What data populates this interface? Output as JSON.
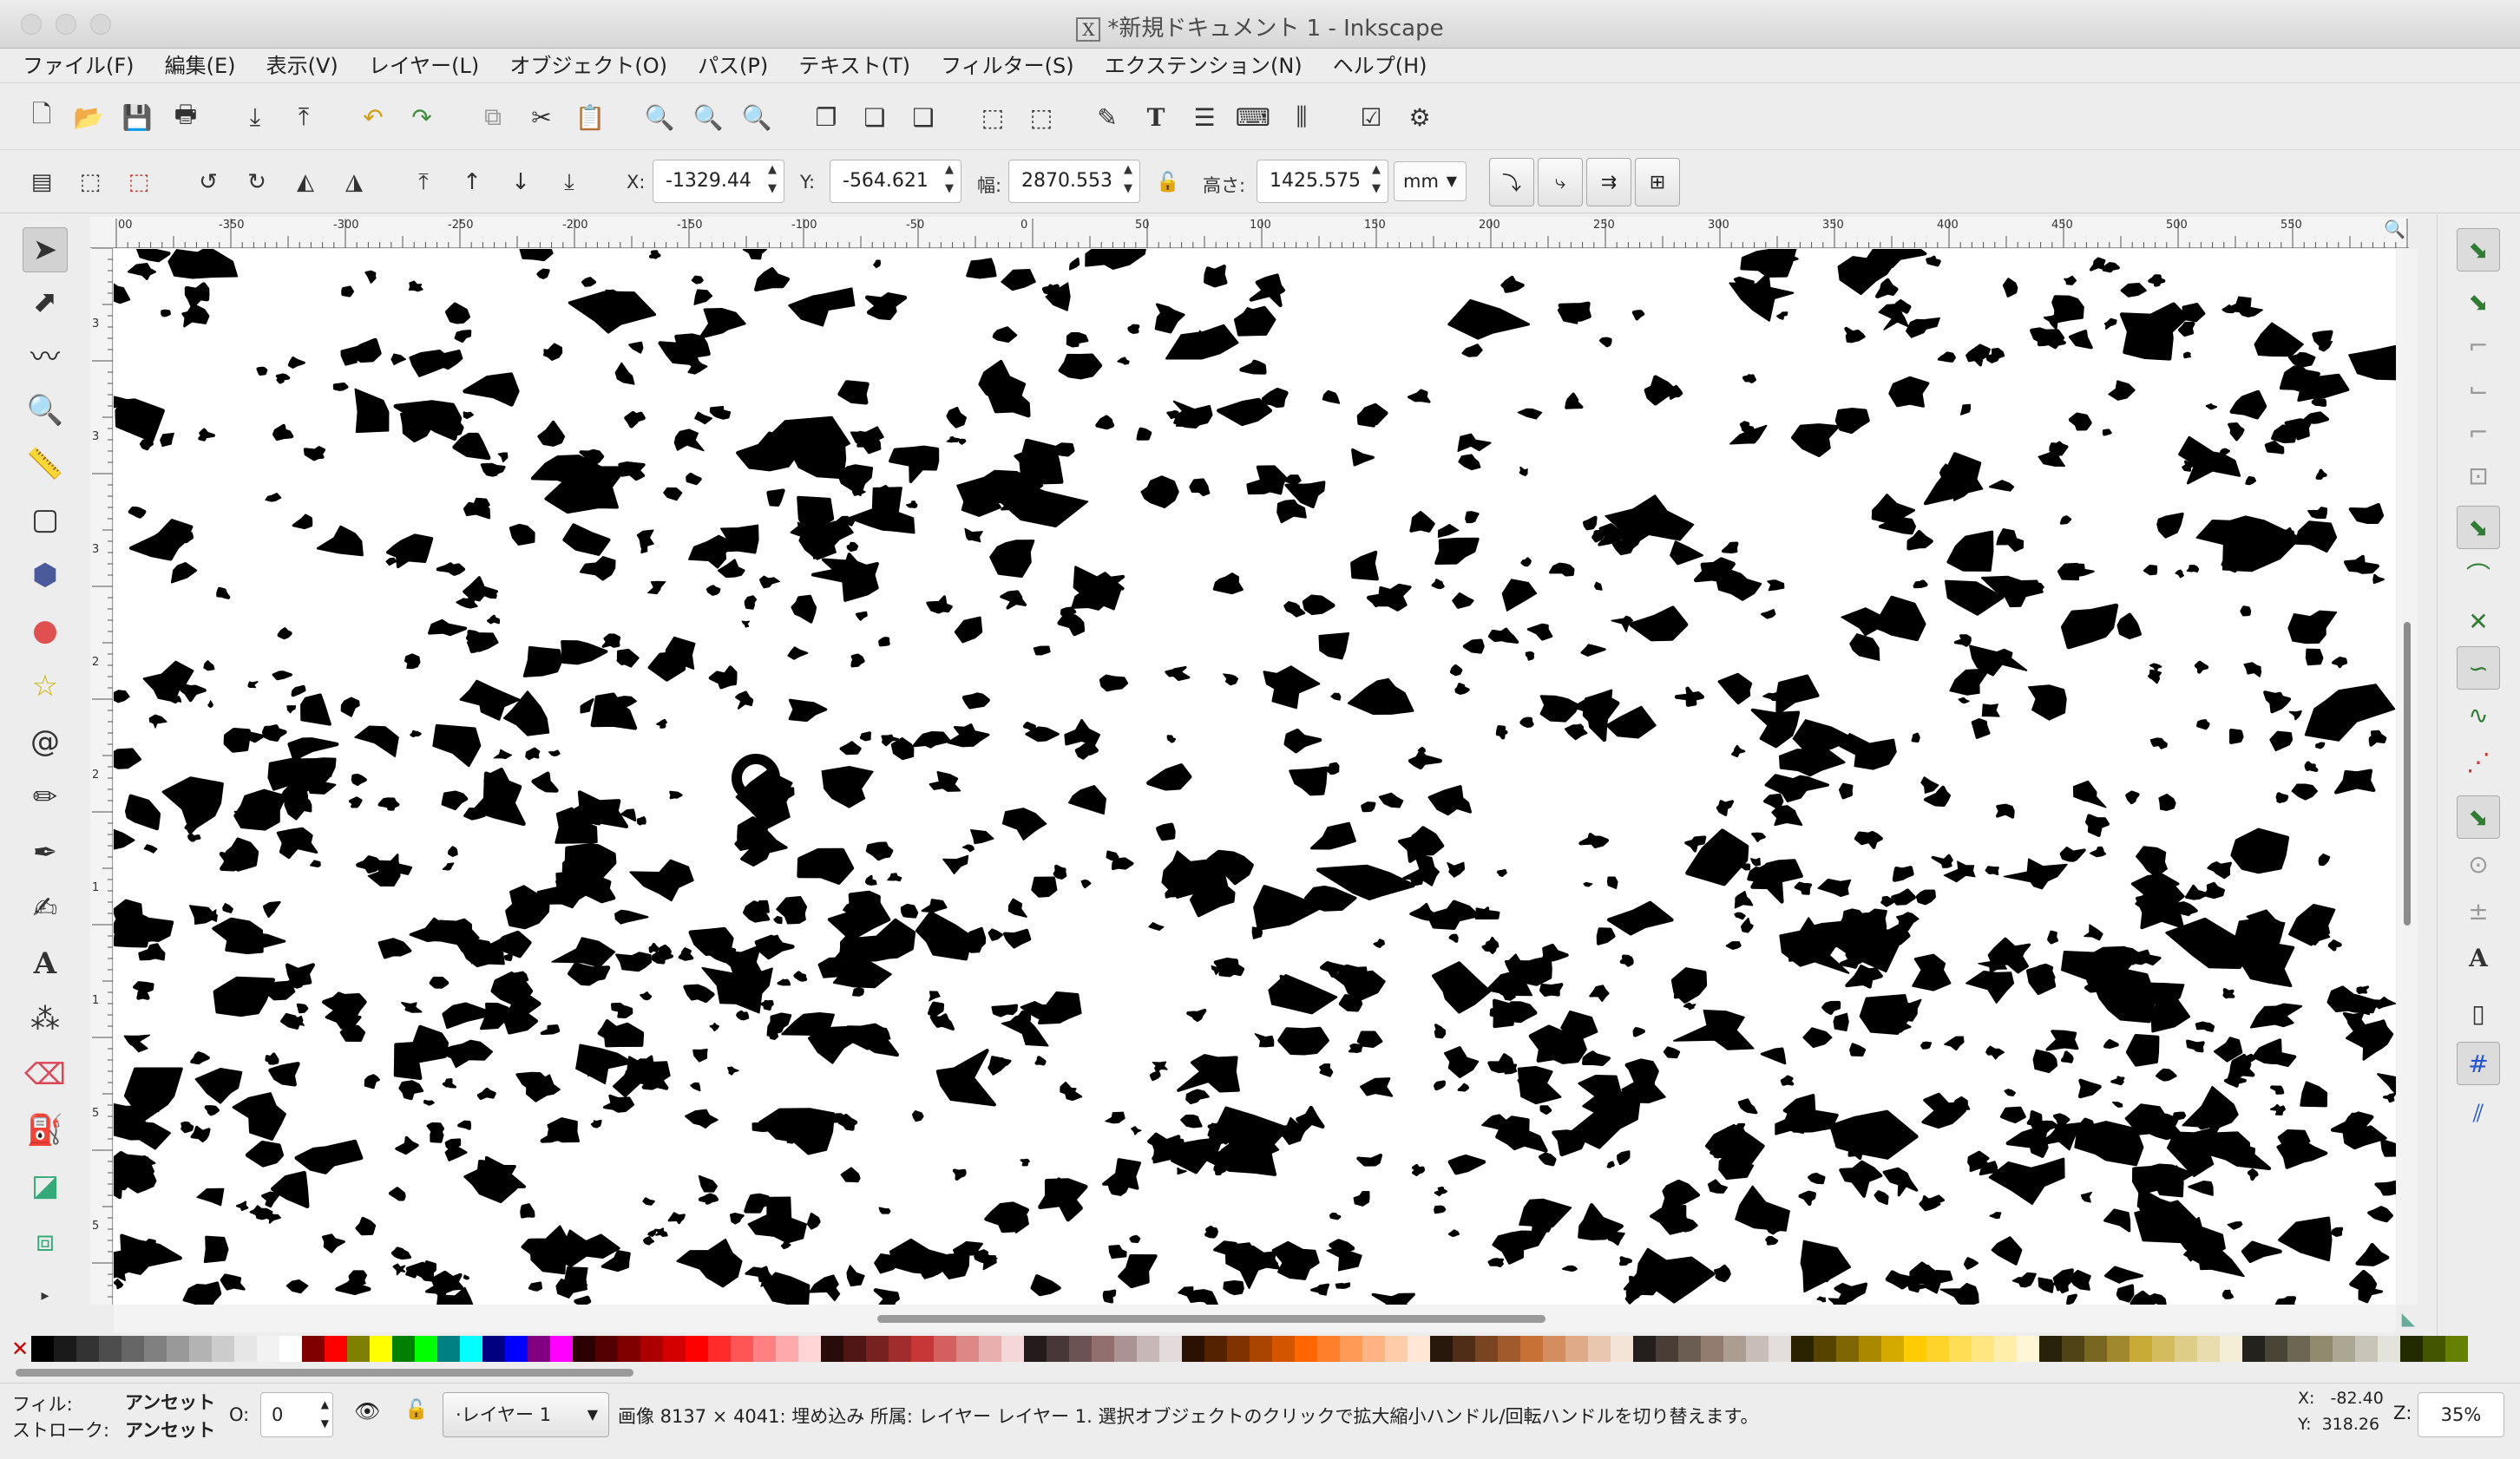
{
  "window": {
    "title": "*新規ドキュメント 1 - Inkscape",
    "app_icon": "x11-icon"
  },
  "menu": [
    "ファイル(F)",
    "編集(E)",
    "表示(V)",
    "レイヤー(L)",
    "オブジェクト(O)",
    "パス(P)",
    "テキスト(T)",
    "フィルター(S)",
    "エクステンション(N)",
    "ヘルプ(H)"
  ],
  "commands_toolbar": [
    "new-document-icon",
    "open-icon",
    "save-icon",
    "print-icon",
    "import-icon",
    "export-icon",
    "undo-icon",
    "redo-icon",
    "copy-icon",
    "cut-icon",
    "paste-icon",
    "zoom-selection-icon",
    "zoom-drawing-icon",
    "zoom-page-icon",
    "duplicate-icon",
    "clone-icon",
    "unlink-clone-icon",
    "group-icon",
    "ungroup-icon",
    "fill-stroke-icon",
    "text-font-icon",
    "layers-icon",
    "xml-editor-icon",
    "align-icon",
    "document-properties-icon",
    "preferences-icon"
  ],
  "select_toolbar": {
    "x_label": "X:",
    "x_value": "-1329.44",
    "y_label": "Y:",
    "y_value": "-564.621",
    "w_label": "幅:",
    "w_value": "2870.553",
    "h_label": "高さ:",
    "h_value": "1425.575",
    "unit": "mm"
  },
  "tools": [
    "selector-icon",
    "node-icon",
    "tweak-icon",
    "zoom-icon",
    "measure-icon",
    "rectangle-icon",
    "box3d-icon",
    "ellipse-icon",
    "star-icon",
    "spiral-icon",
    "pencil-icon",
    "pen-icon",
    "calligraphy-icon",
    "text-icon",
    "spray-icon",
    "eraser-icon",
    "paint-bucket-icon",
    "gradient-icon",
    "mesh-icon"
  ],
  "ruler": {
    "h_labels": [
      "00",
      "-350",
      "-300",
      "-250",
      "-200",
      "-150",
      "-100",
      "-50",
      "0",
      "50",
      "100",
      "150",
      "200",
      "250",
      "300",
      "350",
      "400",
      "450",
      "500",
      "550"
    ],
    "v_labels": [
      "3",
      "3",
      "3",
      "2",
      "2",
      "1",
      "1",
      "5",
      "5",
      "0",
      "5"
    ]
  },
  "canvas": {
    "description_icon": "traced-bitmap-image"
  },
  "snap_toolbar": [
    "snap-toggle-icon",
    "snap-bbox-icon",
    "snap-bbox-edge-icon",
    "snap-bbox-corner-icon",
    "snap-bbox-midpoint-icon",
    "snap-bbox-center-icon",
    "snap-nodes-icon",
    "snap-path-icon",
    "snap-intersection-icon",
    "snap-cusp-icon",
    "snap-smooth-icon",
    "snap-line-midpoint-icon",
    "snap-others-icon",
    "snap-object-center-icon",
    "snap-rotation-center-icon",
    "snap-text-baseline-icon",
    "snap-page-border-icon",
    "snap-grid-icon",
    "snap-guide-icon"
  ],
  "palette_colors": [
    "#000000",
    "#1a1a1a",
    "#333333",
    "#4d4d4d",
    "#666666",
    "#808080",
    "#999999",
    "#b3b3b3",
    "#cccccc",
    "#e6e6e6",
    "#f2f2f2",
    "#ffffff",
    "#800000",
    "#ff0000",
    "#808000",
    "#ffff00",
    "#008000",
    "#00ff00",
    "#008080",
    "#00ffff",
    "#000080",
    "#0000ff",
    "#800080",
    "#ff00ff",
    "#2b0000",
    "#550000",
    "#800000",
    "#aa0000",
    "#d40000",
    "#ff0000",
    "#ff2a2a",
    "#ff5555",
    "#ff8080",
    "#ffaaaa",
    "#ffd5d5",
    "#280b0b",
    "#501616",
    "#782121",
    "#a02c2c",
    "#c83737",
    "#d35f5f",
    "#de8787",
    "#e9afaf",
    "#f4d7d7",
    "#241c1c",
    "#483737",
    "#6c5353",
    "#916f6f",
    "#ac9393",
    "#c8b7b7",
    "#e3dbdb",
    "#2b1100",
    "#552200",
    "#803300",
    "#aa4400",
    "#d45500",
    "#ff6600",
    "#ff7f2a",
    "#ff9955",
    "#ffb380",
    "#ffccaa",
    "#ffe6d5",
    "#28170b",
    "#502d16",
    "#784421",
    "#a05a2c",
    "#c87137",
    "#d38d5f",
    "#deaa87",
    "#e9c6af",
    "#f4e3d7",
    "#241f1c",
    "#483e37",
    "#6c5d53",
    "#917c6f",
    "#ac9d93",
    "#c8beb7",
    "#e3dedb",
    "#2b2200",
    "#554400",
    "#806600",
    "#aa8800",
    "#d4aa00",
    "#ffcc00",
    "#ffd42a",
    "#ffdd55",
    "#ffe680",
    "#ffeeaa",
    "#fff6d5",
    "#28220b",
    "#504416",
    "#786721",
    "#a0892c",
    "#c8ab37",
    "#d3bc5f",
    "#decd87",
    "#e9ddaf",
    "#f4eed7",
    "#24221c",
    "#484537",
    "#6c6753",
    "#918a6f",
    "#aca793",
    "#c8c4b7",
    "#e3e2db",
    "#222b00",
    "#445500",
    "#668000"
  ],
  "status": {
    "fill_label": "フィル:",
    "fill_value": "アンセット",
    "stroke_label": "ストローク:",
    "stroke_value": "アンセット",
    "opacity_label": "O:",
    "opacity_value": "0",
    "layer": "·レイヤー 1",
    "message": "画像 8137 × 4041: 埋め込み 所属: レイヤー レイヤー 1. 選択オブジェクトのクリックで拡大縮小ハンドル/回転ハンドルを切り替えます。",
    "cursor_x": "X:   -82.40",
    "cursor_y": "Y:  318.26",
    "zoom_label": "Z:",
    "zoom_value": "35%"
  }
}
